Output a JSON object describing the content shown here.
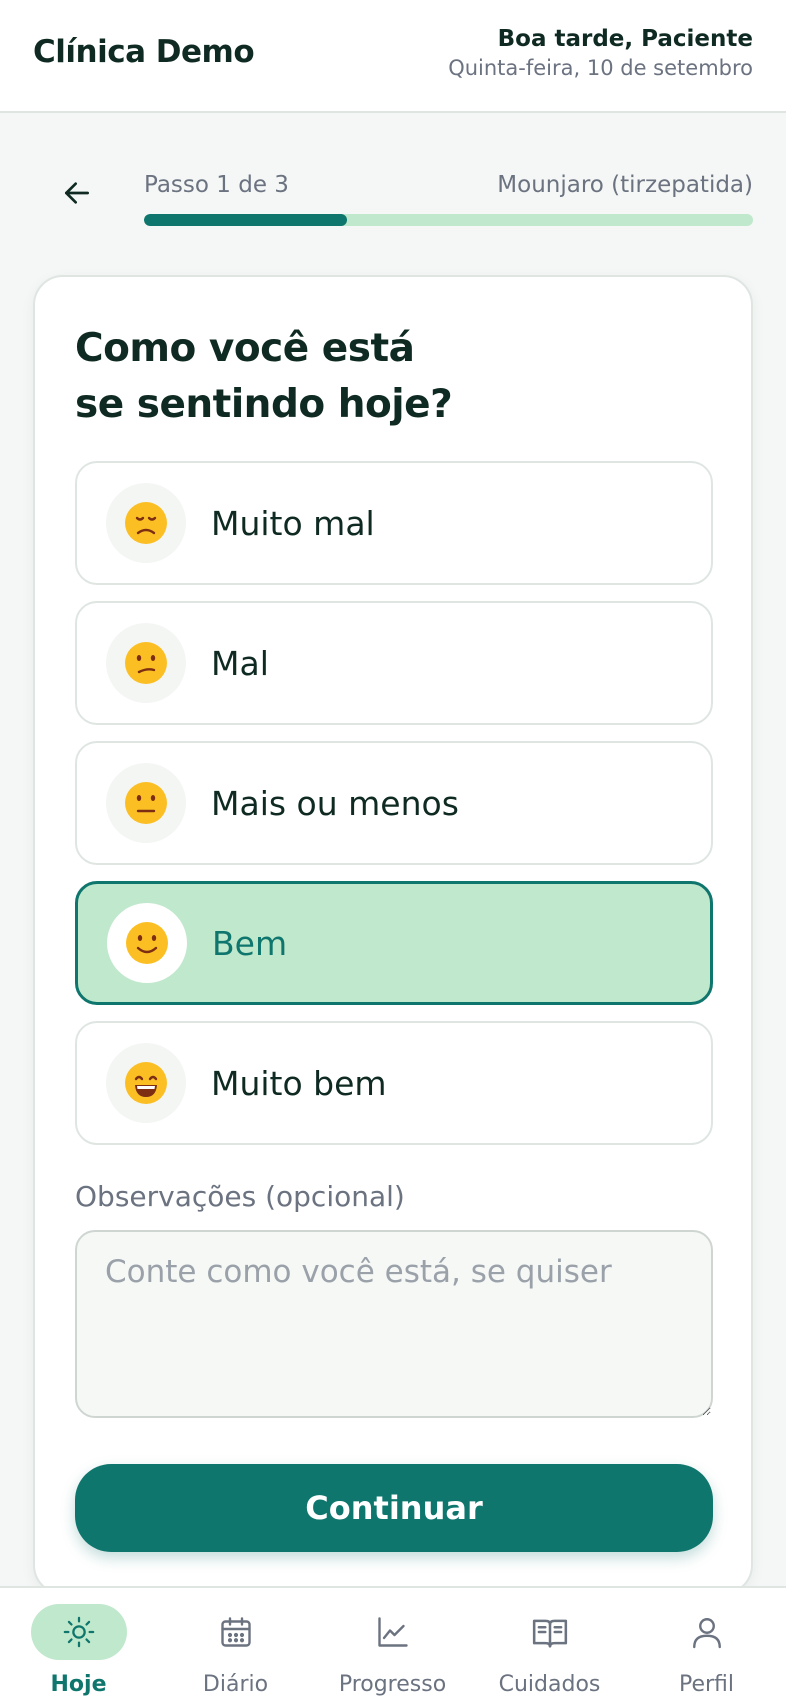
{
  "header": {
    "brand": "Clínica Demo",
    "greeting": "Boa tarde, Paciente",
    "date": "Quinta-feira, 10 de setembro"
  },
  "stepper": {
    "step_label": "Passo 1 de 3",
    "medication": "Mounjaro (tirzepatida)",
    "progress_fraction": 0.333,
    "back_icon": "arrow-left-icon"
  },
  "question": {
    "line1": "Como você está",
    "line2": "se sentindo hoje?"
  },
  "options": [
    {
      "label": "Muito mal",
      "emoji": "😞",
      "selected": false
    },
    {
      "label": "Mal",
      "emoji": "😕",
      "selected": false
    },
    {
      "label": "Mais ou menos",
      "emoji": "😐",
      "selected": false
    },
    {
      "label": "Bem",
      "emoji": "🙂",
      "selected": true
    },
    {
      "label": "Muito bem",
      "emoji": "😄",
      "selected": false
    }
  ],
  "notes": {
    "label": "Observações (opcional)",
    "placeholder": "Conte como você está, se quiser",
    "value": ""
  },
  "continue_label": "Continuar",
  "nav": [
    {
      "label": "Hoje",
      "icon": "sun-icon",
      "active": true
    },
    {
      "label": "Diário",
      "icon": "calendar-icon",
      "active": false
    },
    {
      "label": "Progresso",
      "icon": "chart-line-icon",
      "active": false
    },
    {
      "label": "Cuidados",
      "icon": "book-open-icon",
      "active": false
    },
    {
      "label": "Perfil",
      "icon": "user-icon",
      "active": false
    }
  ],
  "colors": {
    "primary": "#0f766e",
    "selected_bg": "#c0e8cc",
    "text_dark": "#0f2a22",
    "text_muted": "#6b7280"
  }
}
